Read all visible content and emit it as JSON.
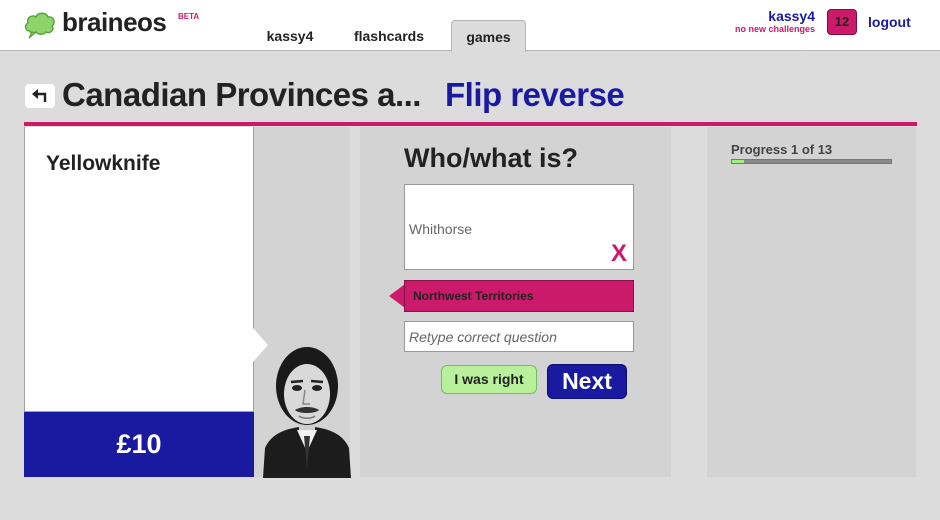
{
  "header": {
    "logo_text": "braineos",
    "beta_label": "BETA",
    "tabs": [
      {
        "label": "kassy4"
      },
      {
        "label": "flashcards"
      },
      {
        "label": "games",
        "active": true
      }
    ],
    "user": {
      "name": "kassy4",
      "status": "no new challenges",
      "count": "12"
    },
    "logout_label": "logout"
  },
  "page": {
    "title": "Canadian Provinces a...",
    "game_mode": "Flip reverse"
  },
  "card": {
    "text": "Yellowknife",
    "prize": "£10"
  },
  "question": {
    "prompt": "Who/what is?",
    "answer_given": "Whithorse",
    "wrong_mark": "X",
    "correct_answer": "Northwest Territories",
    "retype_placeholder": "Retype correct question",
    "was_right_label": "I was right",
    "next_label": "Next"
  },
  "progress": {
    "label": "Progress 1 of 13",
    "fraction": 0.077
  },
  "colors": {
    "accent_pink": "#cc1a6a",
    "brand_blue": "#1a1aa0",
    "success_green": "#b8f09c",
    "progress_green": "#9ef07c"
  },
  "icons": {
    "logo": "brain-cloud-icon",
    "back": "back-arrow-icon",
    "wrong": "x-icon"
  }
}
